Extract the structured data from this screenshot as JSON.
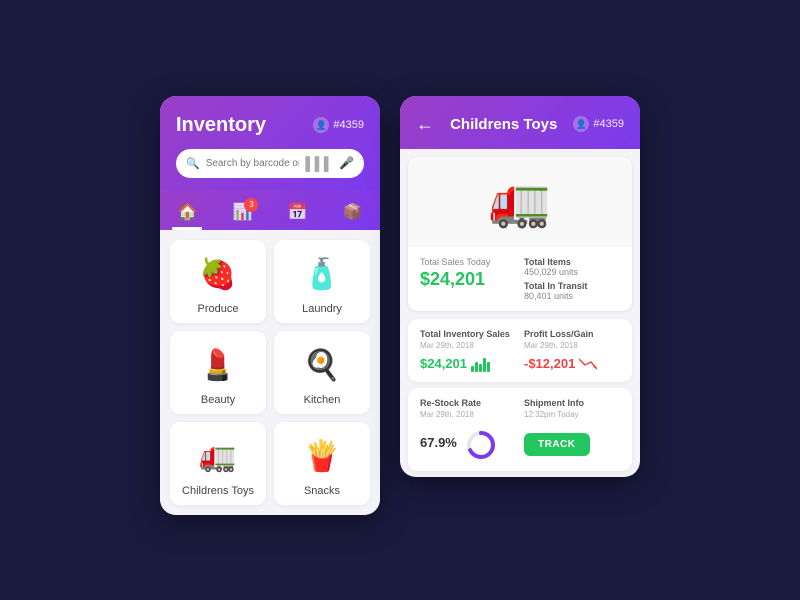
{
  "left": {
    "title": "Inventory",
    "user_id": "#4359",
    "search_placeholder": "Search by barcode or specific...",
    "nav": [
      {
        "icon": "🏠",
        "label": "home",
        "active": true,
        "badge": null
      },
      {
        "icon": "📊",
        "label": "analytics",
        "active": false,
        "badge": "3"
      },
      {
        "icon": "📅",
        "label": "calendar",
        "active": false,
        "badge": null
      },
      {
        "icon": "📦",
        "label": "inventory",
        "active": false,
        "badge": null
      }
    ],
    "categories": [
      {
        "label": "Produce",
        "emoji": "🍓"
      },
      {
        "label": "Laundry",
        "emoji": "🧴"
      },
      {
        "label": "Beauty",
        "emoji": "💄"
      },
      {
        "label": "Kitchen",
        "emoji": "🍳"
      },
      {
        "label": "Childrens Toys",
        "emoji": "🚛"
      },
      {
        "label": "Snacks",
        "emoji": "🍟"
      }
    ]
  },
  "right": {
    "title": "Childrens Toys",
    "user_id": "#4359",
    "product_emoji": "🚛",
    "total_sales_today_label": "Total Sales Today",
    "total_sales_today_value": "$24,201",
    "total_items_label": "Total Items",
    "total_items_value": "450,029 units",
    "total_in_transit_label": "Total In Transit",
    "total_in_transit_value": "80,401 units",
    "inventory_sales_label": "Total Inventory Sales",
    "inventory_sales_date": "Mar 29th, 2018",
    "inventory_sales_value": "$24,201",
    "profit_loss_label": "Profit Loss/Gain",
    "profit_loss_date": "Mar 29th, 2018",
    "profit_loss_value": "-$12,201",
    "restock_label": "Re-Stock Rate",
    "restock_date": "Mar 29th, 2018",
    "restock_value": "67.9%",
    "shipment_label": "Shipment Info",
    "shipment_date": "12:32pm Today",
    "track_label": "TRACK"
  }
}
